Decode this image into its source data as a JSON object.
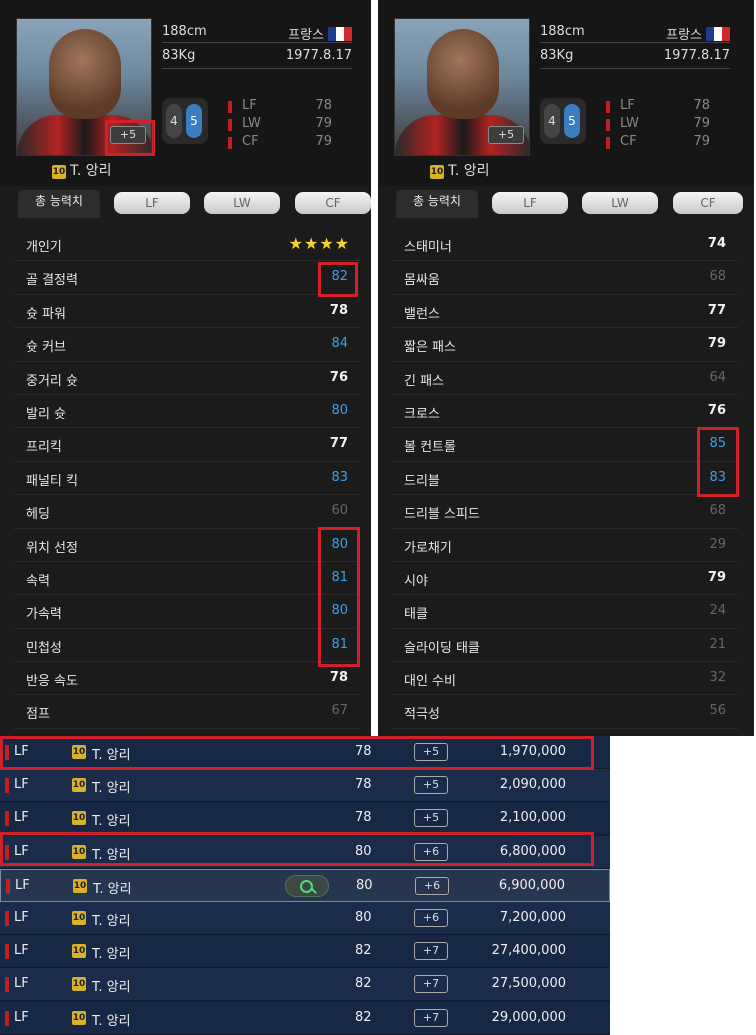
{
  "player": {
    "height": "188cm",
    "weight": "83Kg",
    "nation": "프랑스",
    "birth": "1977.8.17",
    "name": "T. 앙리",
    "badge": "10",
    "upgrade": "+5",
    "foot_left": "4",
    "foot_right": "5",
    "positions": [
      {
        "pos": "LF",
        "val": "78"
      },
      {
        "pos": "LW",
        "val": "79"
      },
      {
        "pos": "CF",
        "val": "79"
      }
    ]
  },
  "tabs": [
    "총 능력치",
    "LF",
    "LW",
    "CF"
  ],
  "left_stats": [
    {
      "label": "개인기",
      "stars": "★★★★"
    },
    {
      "label": "골 결정력",
      "value": "82",
      "tone": "blue"
    },
    {
      "label": "슛 파워",
      "value": "78",
      "tone": "white"
    },
    {
      "label": "슛 커브",
      "value": "84",
      "tone": "blue"
    },
    {
      "label": "중거리 슛",
      "value": "76",
      "tone": "white"
    },
    {
      "label": "발리 슛",
      "value": "80",
      "tone": "blue"
    },
    {
      "label": "프리킥",
      "value": "77",
      "tone": "white"
    },
    {
      "label": "패널티 킥",
      "value": "83",
      "tone": "blue"
    },
    {
      "label": "헤딩",
      "value": "60",
      "tone": "gray"
    },
    {
      "label": "위치 선정",
      "value": "80",
      "tone": "blue"
    },
    {
      "label": "속력",
      "value": "81",
      "tone": "blue"
    },
    {
      "label": "가속력",
      "value": "80",
      "tone": "blue"
    },
    {
      "label": "민첩성",
      "value": "81",
      "tone": "blue"
    },
    {
      "label": "반응 속도",
      "value": "78",
      "tone": "white"
    },
    {
      "label": "점프",
      "value": "67",
      "tone": "gray"
    }
  ],
  "right_stats": [
    {
      "label": "스태미너",
      "value": "74",
      "tone": "white"
    },
    {
      "label": "몸싸움",
      "value": "68",
      "tone": "gray"
    },
    {
      "label": "밸런스",
      "value": "77",
      "tone": "white"
    },
    {
      "label": "짧은 패스",
      "value": "79",
      "tone": "white"
    },
    {
      "label": "긴 패스",
      "value": "64",
      "tone": "gray"
    },
    {
      "label": "크로스",
      "value": "76",
      "tone": "white"
    },
    {
      "label": "볼 컨트롤",
      "value": "85",
      "tone": "blue"
    },
    {
      "label": "드리블",
      "value": "83",
      "tone": "blue"
    },
    {
      "label": "드리블 스피드",
      "value": "68",
      "tone": "gray"
    },
    {
      "label": "가로채기",
      "value": "29",
      "tone": "gray"
    },
    {
      "label": "시야",
      "value": "79",
      "tone": "white"
    },
    {
      "label": "태클",
      "value": "24",
      "tone": "gray"
    },
    {
      "label": "슬라이딩 태클",
      "value": "21",
      "tone": "gray"
    },
    {
      "label": "대인 수비",
      "value": "32",
      "tone": "gray"
    },
    {
      "label": "적극성",
      "value": "56",
      "tone": "gray"
    }
  ],
  "market": [
    {
      "pos": "LF",
      "badge": "10",
      "name": "T. 앙리",
      "ovr": "78",
      "plus": "+5",
      "price": "1,970,000"
    },
    {
      "pos": "LF",
      "badge": "10",
      "name": "T. 앙리",
      "ovr": "78",
      "plus": "+5",
      "price": "2,090,000"
    },
    {
      "pos": "LF",
      "badge": "10",
      "name": "T. 앙리",
      "ovr": "78",
      "plus": "+5",
      "price": "2,100,000"
    },
    {
      "pos": "LF",
      "badge": "10",
      "name": "T. 앙리",
      "ovr": "80",
      "plus": "+6",
      "price": "6,800,000"
    },
    {
      "pos": "LF",
      "badge": "10",
      "name": "T. 앙리",
      "ovr": "80",
      "plus": "+6",
      "price": "6,900,000",
      "selected": true
    },
    {
      "pos": "LF",
      "badge": "10",
      "name": "T. 앙리",
      "ovr": "80",
      "plus": "+6",
      "price": "7,200,000"
    },
    {
      "pos": "LF",
      "badge": "10",
      "name": "T. 앙리",
      "ovr": "82",
      "plus": "+7",
      "price": "27,400,000"
    },
    {
      "pos": "LF",
      "badge": "10",
      "name": "T. 앙리",
      "ovr": "82",
      "plus": "+7",
      "price": "27,500,000"
    },
    {
      "pos": "LF",
      "badge": "10",
      "name": "T. 앙리",
      "ovr": "82",
      "plus": "+7",
      "price": "29,000,000"
    }
  ],
  "colors": {
    "accent_blue": "#3aa0ea",
    "highlight_red": "#d0202a",
    "bar_red": "#c21f1f"
  }
}
